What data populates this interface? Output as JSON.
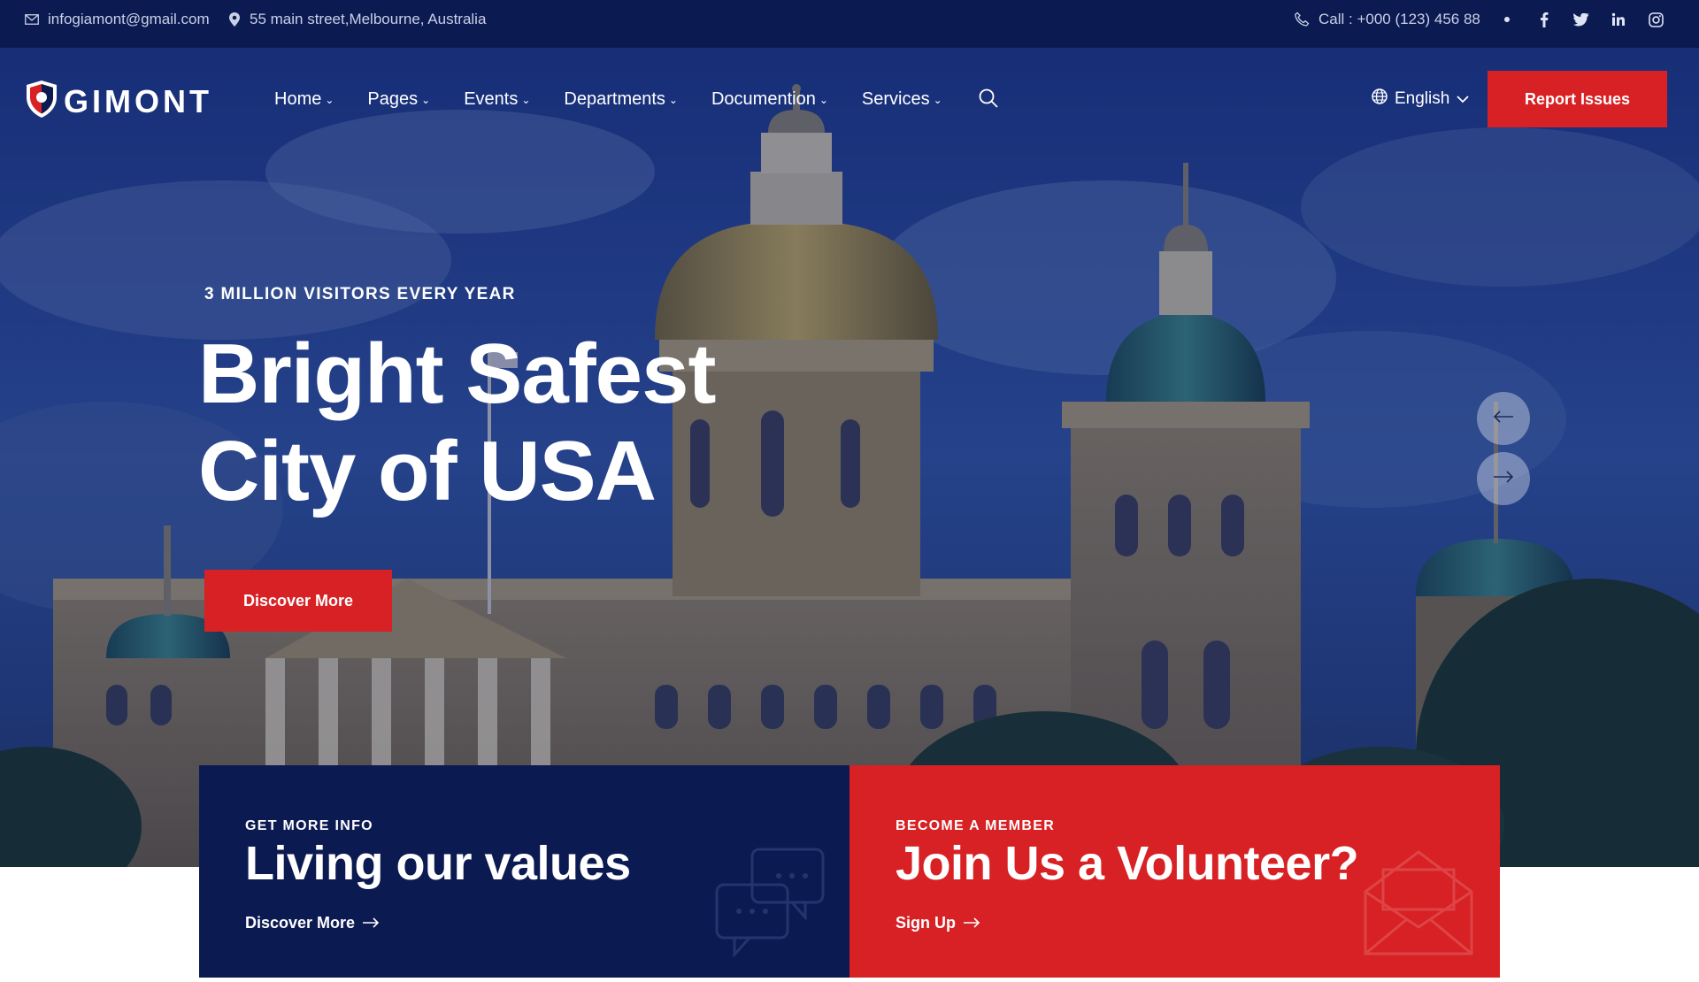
{
  "topbar": {
    "email": "infogiamont@gmail.com",
    "address": "55 main street,Melbourne, Australia",
    "phone": "Call : +000 (123) 456 88",
    "social": [
      {
        "name": "facebook-icon",
        "glyph": "f"
      },
      {
        "name": "twitter-icon",
        "glyph": "t"
      },
      {
        "name": "linkedin-icon",
        "glyph": "in"
      },
      {
        "name": "instagram-icon",
        "glyph": "ig"
      }
    ]
  },
  "nav": {
    "logo": "GIMONT",
    "items": [
      {
        "label": "Home",
        "icon": "chevron-down-icon"
      },
      {
        "label": "Pages",
        "icon": "chevron-down-icon"
      },
      {
        "label": "Events",
        "icon": "chevron-down-icon"
      },
      {
        "label": "Departments",
        "icon": "chevron-down-icon"
      },
      {
        "label": "Documention",
        "icon": "chevron-down-icon"
      },
      {
        "label": "Services",
        "icon": "chevron-down-icon"
      }
    ],
    "language": "English",
    "cta": "Report Issues"
  },
  "hero": {
    "tagline": "3 MILLION VISITORS EVERY YEAR",
    "headline_line1": "Bright Safest",
    "headline_line2": "City of USA",
    "button": "Discover More"
  },
  "cards": [
    {
      "kicker": "GET MORE INFO",
      "title": "Living our values",
      "link": "Discover More",
      "icon": "chat-bubbles-icon"
    },
    {
      "kicker": "BECOME A MEMBER",
      "title": "Join Us a Volunteer?",
      "link": "Sign Up",
      "icon": "envelope-icon"
    }
  ],
  "colors": {
    "navy": "#0c1a52",
    "brand_red": "#d72124",
    "white": "#ffffff"
  }
}
